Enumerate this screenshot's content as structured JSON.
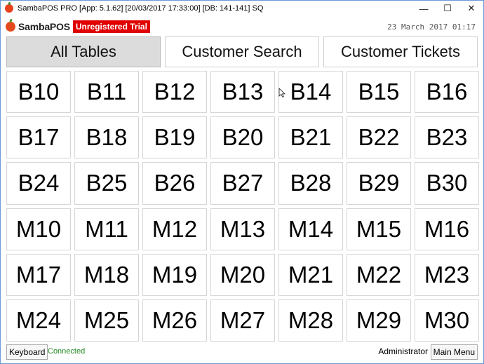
{
  "window": {
    "title": "SambaPOS PRO [App: 5.1.62] [20/03/2017 17:33:00] [DB: 141-141] SQ",
    "minimize": "—",
    "maximize": "☐",
    "close": "✕"
  },
  "header": {
    "logo_text": "SambaPOS",
    "trial_badge": "Unregistered Trial",
    "clock": "23 March 2017 01:17"
  },
  "tabs": [
    {
      "label": "All Tables",
      "active": true
    },
    {
      "label": "Customer Search",
      "active": false
    },
    {
      "label": "Customer Tickets",
      "active": false
    }
  ],
  "tables": [
    "B10",
    "B11",
    "B12",
    "B13",
    "B14",
    "B15",
    "B16",
    "B17",
    "B18",
    "B19",
    "B20",
    "B21",
    "B22",
    "B23",
    "B24",
    "B25",
    "B26",
    "B27",
    "B28",
    "B29",
    "B30",
    "M10",
    "M11",
    "M12",
    "M13",
    "M14",
    "M15",
    "M16",
    "M17",
    "M18",
    "M19",
    "M20",
    "M21",
    "M22",
    "M23",
    "M24",
    "M25",
    "M26",
    "M27",
    "M28",
    "M29",
    "M30"
  ],
  "footer": {
    "keyboard_label": "Keyboard",
    "status": "Connected",
    "user": "Administrator",
    "main_menu_label": "Main Menu"
  }
}
